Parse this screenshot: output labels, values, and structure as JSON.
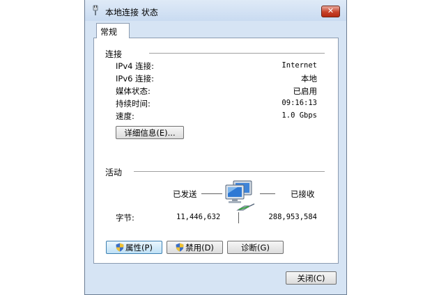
{
  "window": {
    "title": "本地连接 状态",
    "close_symbol": "✕"
  },
  "tab": {
    "label": "常规"
  },
  "connection": {
    "section_title": "连接",
    "rows": [
      {
        "label": "IPv4 连接:",
        "value": "Internet"
      },
      {
        "label": "IPv6 连接:",
        "value": "本地"
      },
      {
        "label": "媒体状态:",
        "value": "已启用"
      },
      {
        "label": "持续时间:",
        "value": "09:16:13"
      },
      {
        "label": "速度:",
        "value": "1.0 Gbps"
      }
    ],
    "details_button": "详细信息(E)..."
  },
  "activity": {
    "section_title": "活动",
    "sent_label": "已发送",
    "received_label": "已接收",
    "bytes_label": "字节:",
    "bytes_sent": "11,446,632",
    "bytes_received": "288,953,584",
    "icon": "network-computer-icon"
  },
  "buttons": {
    "properties": "属性(P)",
    "disable": "禁用(D)",
    "diagnose": "诊断(G)",
    "close": "关闭(C)"
  },
  "colors": {
    "frame": "#d6e4f4",
    "close_button": "#c7422a",
    "shield_blue": "#3a6ec6",
    "shield_yellow": "#f2c230"
  }
}
